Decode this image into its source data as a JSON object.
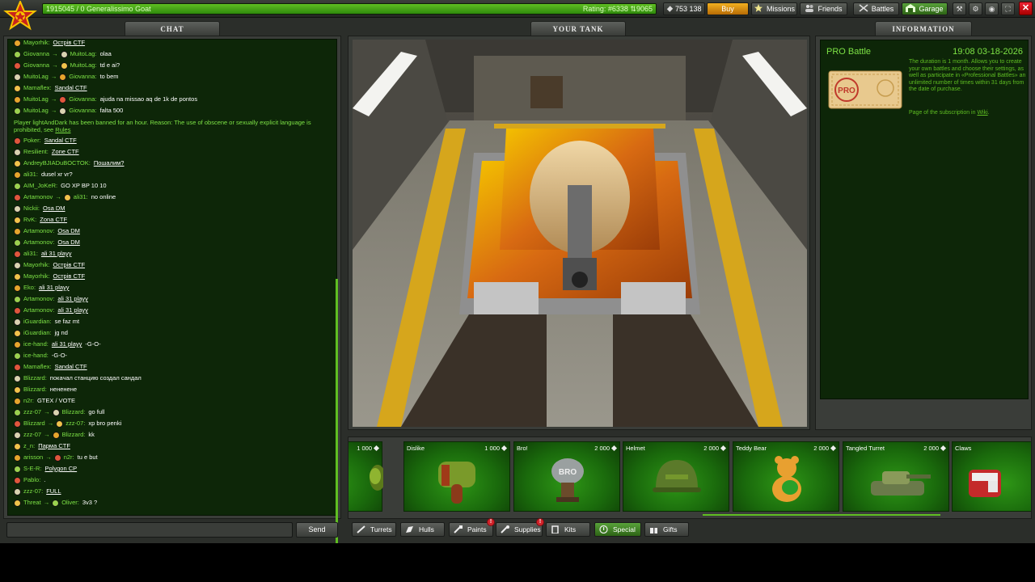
{
  "topbar": {
    "xp_text": "1915045 / 0  Generalissimo Goat",
    "rating_text": "Rating: #6338  ⇅9065",
    "xp_progress_percent": 100,
    "crystals": "753 138",
    "buy_label": "Buy",
    "missions_label": "Missions",
    "friends_label": "Friends",
    "battles_label": "Battles",
    "garage_label": "Garage"
  },
  "headers": {
    "chat": "CHAT",
    "tank": "YOUR TANK",
    "info": "INFORMATION"
  },
  "chat": {
    "send_label": "Send",
    "system_message_pre": "Player lightAndDark has been banned for an hour. Reason: The use of obscene or sexually explicit language is prohibited, see ",
    "system_message_link": "Rules",
    "messages": [
      {
        "from": "Mayorhik",
        "link": "Острів CTF"
      },
      {
        "from": "Giovanna",
        "to": "MuitoLag",
        "text": "olaa"
      },
      {
        "from": "Giovanna",
        "to": "MuitoLag",
        "text": "td e ai?"
      },
      {
        "from": "MuitoLag",
        "to": "Giovanna",
        "text": "to bem"
      },
      {
        "from": "Mamaflex",
        "link": "Sandal CTF"
      },
      {
        "from": "MuitoLag",
        "to": "Giovanna",
        "text": "ajuda na missao aq de 1k de pontos"
      },
      {
        "from": "MuitoLag",
        "to": "Giovanna",
        "text": "falta 500"
      },
      {
        "from": "Poker",
        "link": "Sandal CTF"
      },
      {
        "from": "Resilient",
        "link": "Zone CTF"
      },
      {
        "from": "AndreyBJIADuBOCTOK",
        "link": "Пошалим?"
      },
      {
        "from": "ali31",
        "text": "dusel xr vr?"
      },
      {
        "from": "AIM_JoKeR",
        "text": "GO XP BP 10 10"
      },
      {
        "from": "Artamonov",
        "to": "ali31",
        "text": "no online"
      },
      {
        "from": "Nickii",
        "link": "Osa DM"
      },
      {
        "from": "RvK",
        "link": "Zona CTF"
      },
      {
        "from": "Artamonov",
        "link": "Osa DM"
      },
      {
        "from": "Artamonov",
        "link": "Osa DM"
      },
      {
        "from": "ali31",
        "link": "ali 31 playy"
      },
      {
        "from": "Mayorhik",
        "link": "Острів CTF"
      },
      {
        "from": "Mayorhik",
        "link": "Острів CTF"
      },
      {
        "from": "Eko",
        "link": "ali 31 playy"
      },
      {
        "from": "Artamonov",
        "link": "ali 31 playy"
      },
      {
        "from": "Artamonov",
        "link": "ali 31 playy"
      },
      {
        "from": "iGuardian",
        "text": "se faz mt"
      },
      {
        "from": "iGuardian",
        "text": "jg nd"
      },
      {
        "from": "ice-hand",
        "link": "ali 31 playy",
        "text": "-G-O-"
      },
      {
        "from": "ice-hand",
        "text": "-G-O-"
      },
      {
        "from": "Mamaflex",
        "link": "Sandal CTF"
      },
      {
        "from": "Blizzard",
        "text": "покачал станцию создал сандал"
      },
      {
        "from": "Blizzard",
        "text": "нененене"
      },
      {
        "from": "n2r",
        "text": "GTEX / VOTE"
      },
      {
        "from": "zzz-07",
        "to": "Blizzard",
        "text": "go full"
      },
      {
        "from": "Blizzard",
        "to": "zzz-07",
        "text": "xp bro penki"
      },
      {
        "from": "zzz-07",
        "to": "Blizzard",
        "text": "kk"
      },
      {
        "from": "z_n",
        "link": "Парма CTF"
      },
      {
        "from": "arisson",
        "to": "n2r",
        "text": "tu e but"
      },
      {
        "from": "S-E-R",
        "link": "Polygon CP"
      },
      {
        "from": "Pablo",
        "text": "."
      },
      {
        "from": "zzz-07",
        "link": "FULL"
      },
      {
        "from": "Threat",
        "to": "Oliver",
        "text": "3v3 ?"
      }
    ]
  },
  "info": {
    "title": "PRO Battle",
    "time": "19:08  03-18-2026",
    "description": "The duration is 1 month. Allows you to create your own battles and choose their settings, as well as participate in «Professional Battles» an unlimited number of times within 31 days from the date of purchase.",
    "link_pre": "Page of the subscription in ",
    "link_text": "Wiki",
    "link_post": ".",
    "ticket_stamp": "PRO"
  },
  "shop": {
    "items": [
      {
        "name": "",
        "price": "1 000",
        "icon": "thumb-icon"
      },
      {
        "name": "Dislike",
        "price": "1 000",
        "icon": "thumbs-down-icon"
      },
      {
        "name": "Bro!",
        "price": "2 000",
        "icon": "bro-fist-icon"
      },
      {
        "name": "Helmet",
        "price": "2 000",
        "icon": "helmet-icon"
      },
      {
        "name": "Teddy Bear",
        "price": "2 000",
        "icon": "teddy-bear-icon"
      },
      {
        "name": "Tangled Turret",
        "price": "2 000",
        "icon": "tangled-turret-icon"
      },
      {
        "name": "Claws",
        "price": "",
        "icon": "claws-icon"
      }
    ]
  },
  "categories": [
    {
      "label": "Turrets",
      "icon": "turret-icon"
    },
    {
      "label": "Hulls",
      "icon": "hull-icon"
    },
    {
      "label": "Paints",
      "icon": "paint-icon",
      "badge": "!"
    },
    {
      "label": "Supplies",
      "icon": "supplies-icon",
      "badge": "!"
    },
    {
      "label": "Kits",
      "icon": "kits-icon"
    },
    {
      "label": "Special",
      "icon": "special-icon",
      "active": true
    },
    {
      "label": "Gifts",
      "icon": "gift-icon"
    }
  ],
  "colors": {
    "accent_green": "#5fbe22",
    "name_green": "#7de245",
    "panel_dark_green": "#0d2608",
    "buy_orange": "#e09515",
    "close_red": "#d2232a"
  }
}
